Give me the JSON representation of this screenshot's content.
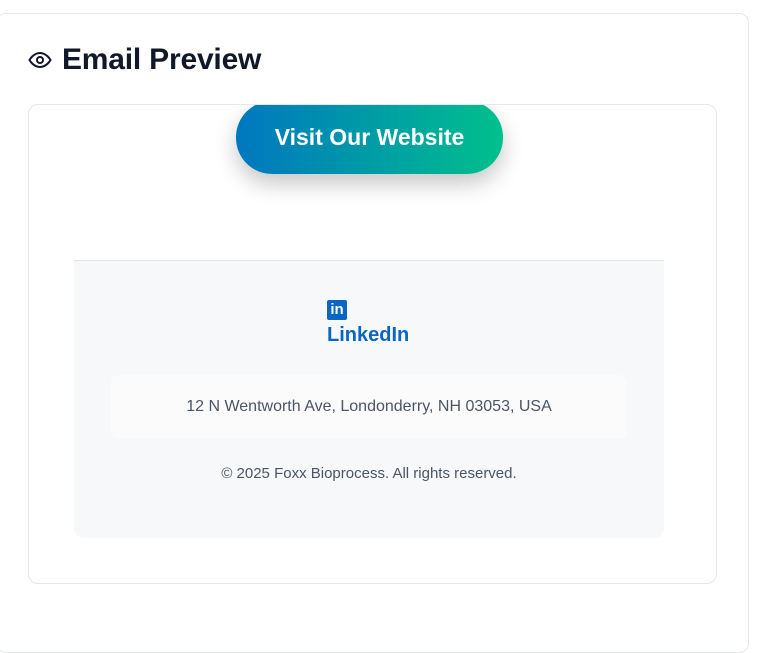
{
  "header": {
    "icon": "eye-icon",
    "title": "Email Preview"
  },
  "email": {
    "cta_label": "Visit Our Website",
    "cta_colors": [
      "#0077c0",
      "#00c08c"
    ],
    "social": {
      "icon": "linkedin-icon",
      "icon_text": "in",
      "label": "LinkedIn",
      "color": "#0a66c2"
    },
    "address": "12 N Wentworth Ave, Londonderry, NH 03053, USA",
    "copyright": "© 2025 Foxx Bioprocess. All rights reserved."
  }
}
